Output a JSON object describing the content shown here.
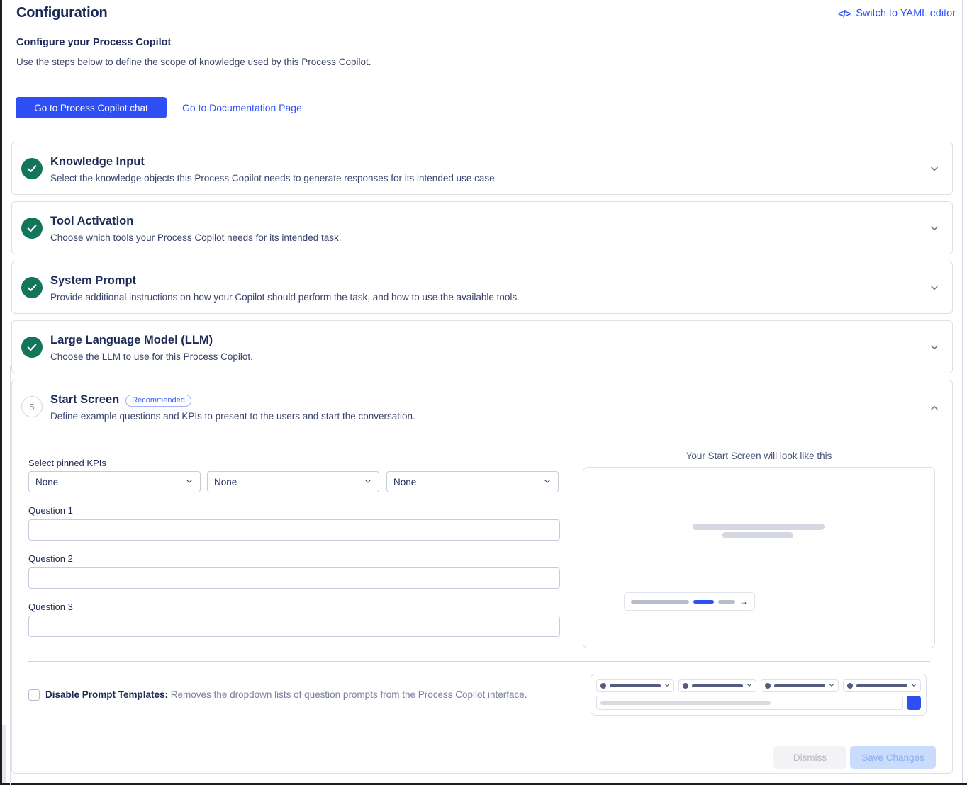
{
  "header": {
    "title": "Configuration",
    "yaml_link": "Switch to YAML editor",
    "yaml_icon": "code-brackets-icon"
  },
  "intro": {
    "heading": "Configure your Process Copilot",
    "description": "Use the steps below to define the scope of knowledge used by this Process Copilot.",
    "primary_button": "Go to Process Copilot chat",
    "link_button": "Go to Documentation Page"
  },
  "colors": {
    "accent_blue": "#2f4ff5",
    "link_blue": "#2f54ff",
    "success_green": "#13755a",
    "text_dark": "#1b2a56",
    "border": "#dcdee8"
  },
  "steps": [
    {
      "id": 1,
      "title": "Knowledge Input",
      "description": "Select the knowledge objects this Process Copilot needs to generate responses for its intended use case.",
      "state": "complete",
      "expanded": false,
      "chevron": "chevron-down-icon"
    },
    {
      "id": 2,
      "title": "Tool Activation",
      "description": "Choose which tools your Process Copilot needs for its intended task.",
      "state": "complete",
      "expanded": false,
      "chevron": "chevron-down-icon"
    },
    {
      "id": 3,
      "title": "System Prompt",
      "description": "Provide additional instructions on how your Copilot should perform the task, and how to use the available tools.",
      "state": "complete",
      "expanded": false,
      "chevron": "chevron-down-icon"
    },
    {
      "id": 4,
      "title": "Large Language Model (LLM)",
      "description": "Choose the LLM to use for this Process Copilot.",
      "state": "complete",
      "expanded": false,
      "chevron": "chevron-down-icon"
    },
    {
      "id": 5,
      "number_label": "5",
      "title": "Start Screen",
      "badge": "Recommended",
      "description": "Define example questions and KPIs to present to the users and start the conversation.",
      "state": "pending",
      "expanded": true,
      "chevron": "chevron-up-icon"
    }
  ],
  "start_screen": {
    "kpi_label": "Select pinned KPIs",
    "kpi_selects": [
      {
        "value": "None"
      },
      {
        "value": "None"
      },
      {
        "value": "None"
      }
    ],
    "questions": [
      {
        "label": "Question 1",
        "value": "",
        "placeholder": ""
      },
      {
        "label": "Question 2",
        "value": "",
        "placeholder": ""
      },
      {
        "label": "Question 3",
        "value": "",
        "placeholder": ""
      }
    ],
    "preview_caption": "Your Start Screen will look like this",
    "disable_templates": {
      "checked": false,
      "label_bold": "Disable Prompt Templates:",
      "label_rest": " Removes the dropdown lists of question prompts from the Process Copilot interface."
    }
  },
  "footer": {
    "dismiss_label": "Dismiss",
    "save_label": "Save Changes",
    "dismiss_disabled": true,
    "save_disabled": true
  }
}
